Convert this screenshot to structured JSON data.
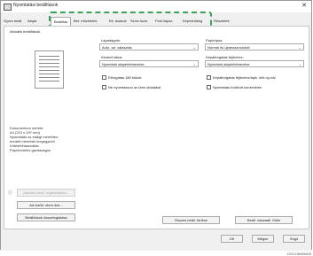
{
  "window": {
    "title": "Nyomtatási beállítások"
  },
  "tabs": [
    "Gyors beáll.",
    "Alapb.",
    "Beállítás",
    "Bef. műveletek",
    "Elr. ázasok",
    "Színv./szín.",
    "Fedl./lapsz.",
    "Képminőség",
    "Részletek"
  ],
  "left": {
    "current_settings": "Aktuális beállítások",
    "doc_info": "Dokumentum mérete:\nA4 (210 x 297 mm)\nNyomtatás az eddigi mérethez:\neredeti méretnél megegyező\nKötésfelhasználás:\nPapírkímélés gazdaságos",
    "btn_register": "Aktuális beáll. regisztrálása...",
    "btn_list": "Ad./szűrt. elem./kör...",
    "btn_confirm": "Beállítások összefoglalása"
  },
  "form": {
    "paper_source_label": "Lapadagoló:",
    "paper_source_value": "Auto. ad. választás",
    "paper_type_label": "Papírtípus:",
    "paper_type_value": "Normál és újrahasznosított",
    "cover_label": "Kimenő tálca:",
    "cover_value": "Nyomtató alapértelmezése",
    "image_label": "Képalforgatás fejléchez:",
    "image_value": "Nyomtató alapértelmezése",
    "cb1": "Elforgatás 180 fokkal",
    "cb2": "Képalforgatás fejléchez/lapk. lekt.ny-nál",
    "cb3": "Ne nyomtasson az üres oldalakat",
    "cb4": "Nyomtatás fordított sorrendben"
  },
  "buttons": {
    "reset_all": "Összes beáll. törlése",
    "restore": "Beáll. visszaáll. fülön",
    "ok": "OK",
    "cancel": "Mégse",
    "help": "Súgó"
  },
  "ref_code": "DGCHWA5605"
}
